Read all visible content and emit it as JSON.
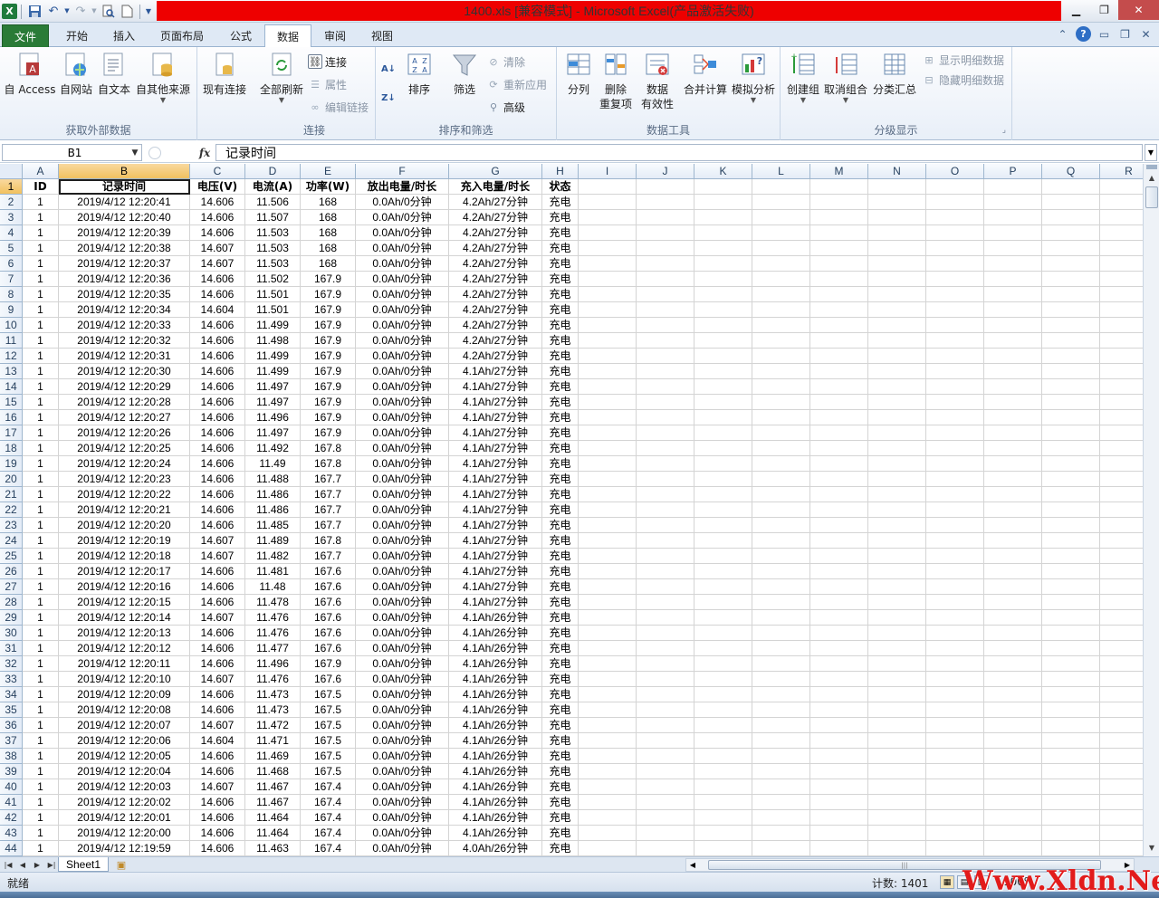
{
  "window": {
    "title": "1400.xls  [兼容模式]  -  Microsoft Excel(产品激活失败)"
  },
  "tabs": [
    "文件",
    "开始",
    "插入",
    "页面布局",
    "公式",
    "数据",
    "审阅",
    "视图"
  ],
  "ribbon": {
    "groups": {
      "external": {
        "label": "获取外部数据",
        "access": "自 Access",
        "web": "自网站",
        "text": "自文本",
        "other": "自其他来源",
        "existing": "现有连接"
      },
      "connections": {
        "label": "连接",
        "refresh_all": "全部刷新",
        "connections": "连接",
        "properties": "属性",
        "edit_links": "编辑链接"
      },
      "sort_filter": {
        "label": "排序和筛选",
        "sort": "排序",
        "filter": "筛选",
        "clear": "清除",
        "reapply": "重新应用",
        "advanced": "高级"
      },
      "data_tools": {
        "label": "数据工具",
        "text_to_columns": "分列",
        "remove_dup_1": "删除",
        "remove_dup_2": "重复项",
        "validation_1": "数据",
        "validation_2": "有效性",
        "consolidate": "合并计算",
        "whatif": "模拟分析"
      },
      "outline": {
        "label": "分级显示",
        "group": "创建组",
        "ungroup": "取消组合",
        "subtotal": "分类汇总",
        "show_detail": "显示明细数据",
        "hide_detail": "隐藏明细数据"
      }
    }
  },
  "formula_bar": {
    "name_box": "B1",
    "fx": "fx",
    "content": "记录时间"
  },
  "columns": [
    "A",
    "B",
    "C",
    "D",
    "E",
    "F",
    "G",
    "H",
    "I",
    "J",
    "K",
    "L",
    "M",
    "N",
    "O",
    "P",
    "Q",
    "R"
  ],
  "header_row": [
    "ID",
    "记录时间",
    "电压(V)",
    "电流(A)",
    "功率(W)",
    "放出电量/时长",
    "充入电量/时长",
    "状态"
  ],
  "rows": [
    [
      "1",
      "2019/4/12 12:20:41",
      "14.606",
      "11.506",
      "168",
      "0.0Ah/0分钟",
      "4.2Ah/27分钟",
      "充电"
    ],
    [
      "1",
      "2019/4/12 12:20:40",
      "14.606",
      "11.507",
      "168",
      "0.0Ah/0分钟",
      "4.2Ah/27分钟",
      "充电"
    ],
    [
      "1",
      "2019/4/12 12:20:39",
      "14.606",
      "11.503",
      "168",
      "0.0Ah/0分钟",
      "4.2Ah/27分钟",
      "充电"
    ],
    [
      "1",
      "2019/4/12 12:20:38",
      "14.607",
      "11.503",
      "168",
      "0.0Ah/0分钟",
      "4.2Ah/27分钟",
      "充电"
    ],
    [
      "1",
      "2019/4/12 12:20:37",
      "14.607",
      "11.503",
      "168",
      "0.0Ah/0分钟",
      "4.2Ah/27分钟",
      "充电"
    ],
    [
      "1",
      "2019/4/12 12:20:36",
      "14.606",
      "11.502",
      "167.9",
      "0.0Ah/0分钟",
      "4.2Ah/27分钟",
      "充电"
    ],
    [
      "1",
      "2019/4/12 12:20:35",
      "14.606",
      "11.501",
      "167.9",
      "0.0Ah/0分钟",
      "4.2Ah/27分钟",
      "充电"
    ],
    [
      "1",
      "2019/4/12 12:20:34",
      "14.604",
      "11.501",
      "167.9",
      "0.0Ah/0分钟",
      "4.2Ah/27分钟",
      "充电"
    ],
    [
      "1",
      "2019/4/12 12:20:33",
      "14.606",
      "11.499",
      "167.9",
      "0.0Ah/0分钟",
      "4.2Ah/27分钟",
      "充电"
    ],
    [
      "1",
      "2019/4/12 12:20:32",
      "14.606",
      "11.498",
      "167.9",
      "0.0Ah/0分钟",
      "4.2Ah/27分钟",
      "充电"
    ],
    [
      "1",
      "2019/4/12 12:20:31",
      "14.606",
      "11.499",
      "167.9",
      "0.0Ah/0分钟",
      "4.2Ah/27分钟",
      "充电"
    ],
    [
      "1",
      "2019/4/12 12:20:30",
      "14.606",
      "11.499",
      "167.9",
      "0.0Ah/0分钟",
      "4.1Ah/27分钟",
      "充电"
    ],
    [
      "1",
      "2019/4/12 12:20:29",
      "14.606",
      "11.497",
      "167.9",
      "0.0Ah/0分钟",
      "4.1Ah/27分钟",
      "充电"
    ],
    [
      "1",
      "2019/4/12 12:20:28",
      "14.606",
      "11.497",
      "167.9",
      "0.0Ah/0分钟",
      "4.1Ah/27分钟",
      "充电"
    ],
    [
      "1",
      "2019/4/12 12:20:27",
      "14.606",
      "11.496",
      "167.9",
      "0.0Ah/0分钟",
      "4.1Ah/27分钟",
      "充电"
    ],
    [
      "1",
      "2019/4/12 12:20:26",
      "14.606",
      "11.497",
      "167.9",
      "0.0Ah/0分钟",
      "4.1Ah/27分钟",
      "充电"
    ],
    [
      "1",
      "2019/4/12 12:20:25",
      "14.606",
      "11.492",
      "167.8",
      "0.0Ah/0分钟",
      "4.1Ah/27分钟",
      "充电"
    ],
    [
      "1",
      "2019/4/12 12:20:24",
      "14.606",
      "11.49",
      "167.8",
      "0.0Ah/0分钟",
      "4.1Ah/27分钟",
      "充电"
    ],
    [
      "1",
      "2019/4/12 12:20:23",
      "14.606",
      "11.488",
      "167.7",
      "0.0Ah/0分钟",
      "4.1Ah/27分钟",
      "充电"
    ],
    [
      "1",
      "2019/4/12 12:20:22",
      "14.606",
      "11.486",
      "167.7",
      "0.0Ah/0分钟",
      "4.1Ah/27分钟",
      "充电"
    ],
    [
      "1",
      "2019/4/12 12:20:21",
      "14.606",
      "11.486",
      "167.7",
      "0.0Ah/0分钟",
      "4.1Ah/27分钟",
      "充电"
    ],
    [
      "1",
      "2019/4/12 12:20:20",
      "14.606",
      "11.485",
      "167.7",
      "0.0Ah/0分钟",
      "4.1Ah/27分钟",
      "充电"
    ],
    [
      "1",
      "2019/4/12 12:20:19",
      "14.607",
      "11.489",
      "167.8",
      "0.0Ah/0分钟",
      "4.1Ah/27分钟",
      "充电"
    ],
    [
      "1",
      "2019/4/12 12:20:18",
      "14.607",
      "11.482",
      "167.7",
      "0.0Ah/0分钟",
      "4.1Ah/27分钟",
      "充电"
    ],
    [
      "1",
      "2019/4/12 12:20:17",
      "14.606",
      "11.481",
      "167.6",
      "0.0Ah/0分钟",
      "4.1Ah/27分钟",
      "充电"
    ],
    [
      "1",
      "2019/4/12 12:20:16",
      "14.606",
      "11.48",
      "167.6",
      "0.0Ah/0分钟",
      "4.1Ah/27分钟",
      "充电"
    ],
    [
      "1",
      "2019/4/12 12:20:15",
      "14.606",
      "11.478",
      "167.6",
      "0.0Ah/0分钟",
      "4.1Ah/27分钟",
      "充电"
    ],
    [
      "1",
      "2019/4/12 12:20:14",
      "14.607",
      "11.476",
      "167.6",
      "0.0Ah/0分钟",
      "4.1Ah/26分钟",
      "充电"
    ],
    [
      "1",
      "2019/4/12 12:20:13",
      "14.606",
      "11.476",
      "167.6",
      "0.0Ah/0分钟",
      "4.1Ah/26分钟",
      "充电"
    ],
    [
      "1",
      "2019/4/12 12:20:12",
      "14.606",
      "11.477",
      "167.6",
      "0.0Ah/0分钟",
      "4.1Ah/26分钟",
      "充电"
    ],
    [
      "1",
      "2019/4/12 12:20:11",
      "14.606",
      "11.496",
      "167.9",
      "0.0Ah/0分钟",
      "4.1Ah/26分钟",
      "充电"
    ],
    [
      "1",
      "2019/4/12 12:20:10",
      "14.607",
      "11.476",
      "167.6",
      "0.0Ah/0分钟",
      "4.1Ah/26分钟",
      "充电"
    ],
    [
      "1",
      "2019/4/12 12:20:09",
      "14.606",
      "11.473",
      "167.5",
      "0.0Ah/0分钟",
      "4.1Ah/26分钟",
      "充电"
    ],
    [
      "1",
      "2019/4/12 12:20:08",
      "14.606",
      "11.473",
      "167.5",
      "0.0Ah/0分钟",
      "4.1Ah/26分钟",
      "充电"
    ],
    [
      "1",
      "2019/4/12 12:20:07",
      "14.607",
      "11.472",
      "167.5",
      "0.0Ah/0分钟",
      "4.1Ah/26分钟",
      "充电"
    ],
    [
      "1",
      "2019/4/12 12:20:06",
      "14.604",
      "11.471",
      "167.5",
      "0.0Ah/0分钟",
      "4.1Ah/26分钟",
      "充电"
    ],
    [
      "1",
      "2019/4/12 12:20:05",
      "14.606",
      "11.469",
      "167.5",
      "0.0Ah/0分钟",
      "4.1Ah/26分钟",
      "充电"
    ],
    [
      "1",
      "2019/4/12 12:20:04",
      "14.606",
      "11.468",
      "167.5",
      "0.0Ah/0分钟",
      "4.1Ah/26分钟",
      "充电"
    ],
    [
      "1",
      "2019/4/12 12:20:03",
      "14.607",
      "11.467",
      "167.4",
      "0.0Ah/0分钟",
      "4.1Ah/26分钟",
      "充电"
    ],
    [
      "1",
      "2019/4/12 12:20:02",
      "14.606",
      "11.467",
      "167.4",
      "0.0Ah/0分钟",
      "4.1Ah/26分钟",
      "充电"
    ],
    [
      "1",
      "2019/4/12 12:20:01",
      "14.606",
      "11.464",
      "167.4",
      "0.0Ah/0分钟",
      "4.1Ah/26分钟",
      "充电"
    ],
    [
      "1",
      "2019/4/12 12:20:00",
      "14.606",
      "11.464",
      "167.4",
      "0.0Ah/0分钟",
      "4.1Ah/26分钟",
      "充电"
    ],
    [
      "1",
      "2019/4/12 12:19:59",
      "14.606",
      "11.463",
      "167.4",
      "0.0Ah/0分钟",
      "4.0Ah/26分钟",
      "充电"
    ]
  ],
  "sheet": {
    "name": "Sheet1"
  },
  "status": {
    "ready": "就绪",
    "count": "计数: 1401",
    "zoom": "100%"
  },
  "watermark": "Www.Xldn.Net",
  "colors": {
    "title_bar_red": "#ee0000",
    "file_tab": "#2a7b37",
    "watermark": "#e21b1b"
  }
}
